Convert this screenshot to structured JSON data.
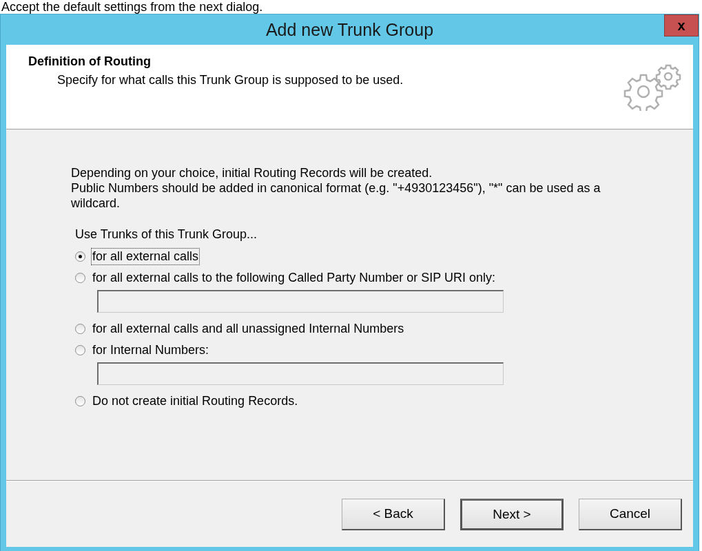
{
  "caption": "Accept the default settings from the next dialog.",
  "window": {
    "title": "Add new Trunk Group",
    "close": "x"
  },
  "header": {
    "title": "Definition of Routing",
    "subtitle": "Specify for what calls this Trunk Group is supposed to be used."
  },
  "intro": [
    "Depending on your choice, initial Routing Records will be created.",
    "Public Numbers should be added in canonical format (e.g. \"+4930123456\"), \"*\" can be used as a wildcard."
  ],
  "group_label": "Use Trunks of this Trunk Group...",
  "options": [
    {
      "label": "for all external calls",
      "selected": true,
      "kind": "plain"
    },
    {
      "label": "for all external calls to the following Called Party Number or SIP URI only:",
      "selected": false,
      "kind": "with-field"
    },
    {
      "label": "for all external calls and all unassigned Internal Numbers",
      "selected": false,
      "kind": "plain"
    },
    {
      "label": "for Internal Numbers:",
      "selected": false,
      "kind": "with-field"
    },
    {
      "label": "Do not create initial Routing Records.",
      "selected": false,
      "kind": "plain"
    }
  ],
  "buttons": [
    {
      "label": "< Back",
      "default": false
    },
    {
      "label": "Next >",
      "default": true
    },
    {
      "label": "Cancel",
      "default": false
    }
  ]
}
